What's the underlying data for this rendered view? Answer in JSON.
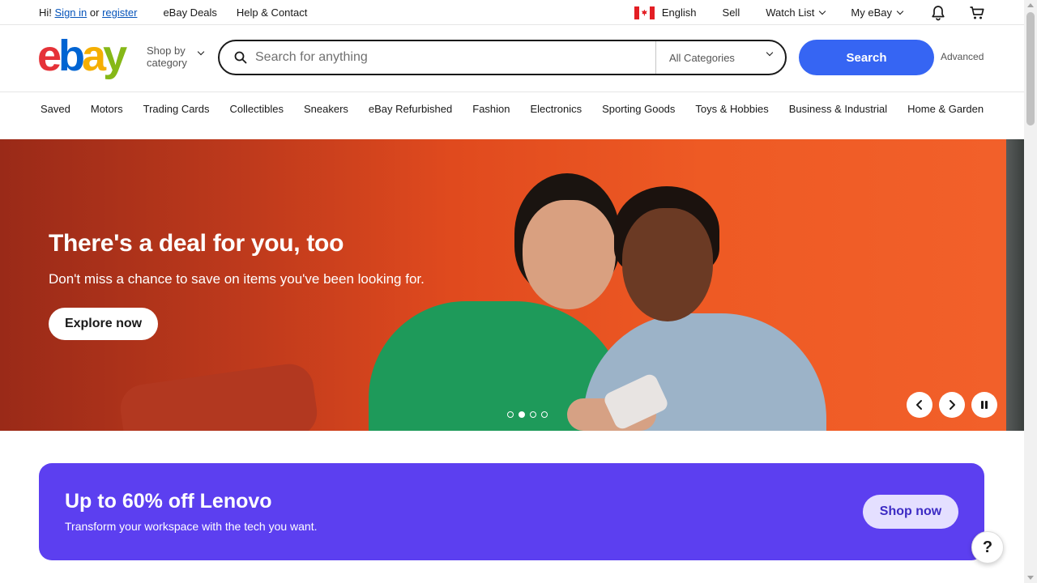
{
  "topbar": {
    "greeting": "Hi!",
    "sign_in": "Sign in",
    "or": "or",
    "register": "register",
    "deals": "eBay Deals",
    "help": "Help & Contact",
    "language": "English",
    "sell": "Sell",
    "watch_list": "Watch List",
    "my_ebay": "My eBay"
  },
  "header": {
    "logo": {
      "e": "e",
      "b": "b",
      "a": "a",
      "y": "y"
    },
    "shop_by_line1": "Shop by",
    "shop_by_line2": "category",
    "search_placeholder": "Search for anything",
    "category": "All Categories",
    "search_button": "Search",
    "advanced": "Advanced"
  },
  "nav": [
    "Saved",
    "Motors",
    "Trading Cards",
    "Collectibles",
    "Sneakers",
    "eBay Refurbished",
    "Fashion",
    "Electronics",
    "Sporting Goods",
    "Toys & Hobbies",
    "Business & Industrial",
    "Home & Garden"
  ],
  "hero": {
    "title": "There's a deal for you, too",
    "subtitle": "Don't miss a chance to save on items you've been looking for.",
    "cta": "Explore now",
    "slide_count": 4,
    "active_slide": 2
  },
  "promo": {
    "title": "Up to 60% off Lenovo",
    "subtitle": "Transform your workspace with the tech you want.",
    "cta": "Shop now"
  },
  "help_label": "?",
  "colors": {
    "search_blue": "#3665f3",
    "link_blue": "#0654ba",
    "promo_purple": "#5c3ff0",
    "hero_orange": "#e04a1e"
  }
}
